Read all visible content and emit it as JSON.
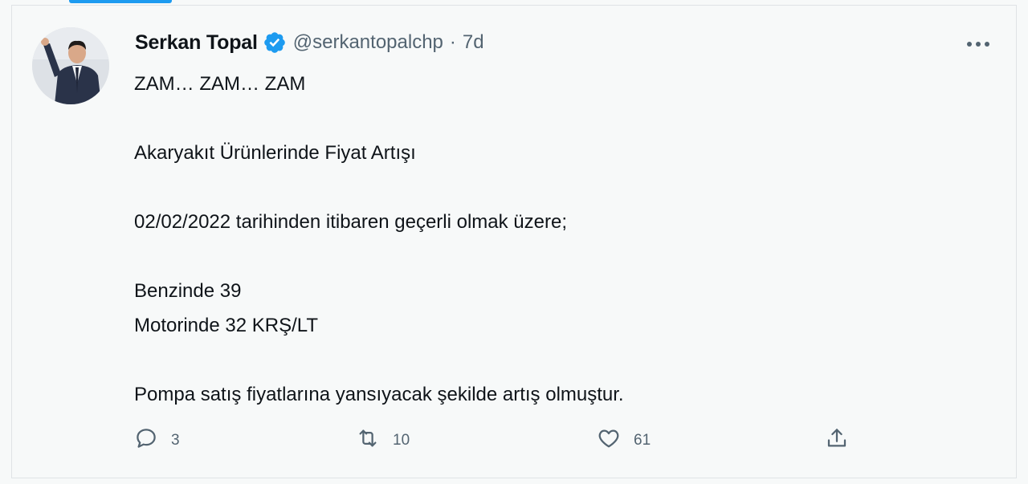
{
  "tweet": {
    "author": {
      "name": "Serkan Topal",
      "handle": "@serkantopalchp",
      "separator": "·",
      "time": "7d"
    },
    "text_lines": [
      "ZAM… ZAM… ZAM",
      "Akaryakıt Ürünlerinde Fiyat Artışı",
      "02/02/2022 tarihinden itibaren geçerli olmak üzere;",
      "Benzinde 39",
      "Motorinde 32 KRŞ/LT",
      "Pompa satış fiyatlarına yansıyacak şekilde artış olmuştur."
    ],
    "actions": {
      "replies": "3",
      "retweets": "10",
      "likes": "61"
    }
  },
  "icons": {
    "verified": "verified-badge-icon",
    "more": "more-icon",
    "reply": "reply-icon",
    "retweet": "retweet-icon",
    "like": "heart-icon",
    "share": "share-icon"
  },
  "colors": {
    "accent": "#1d9bf0",
    "text": "#0f1419",
    "secondary": "#536471",
    "background": "#f7f9f9"
  }
}
